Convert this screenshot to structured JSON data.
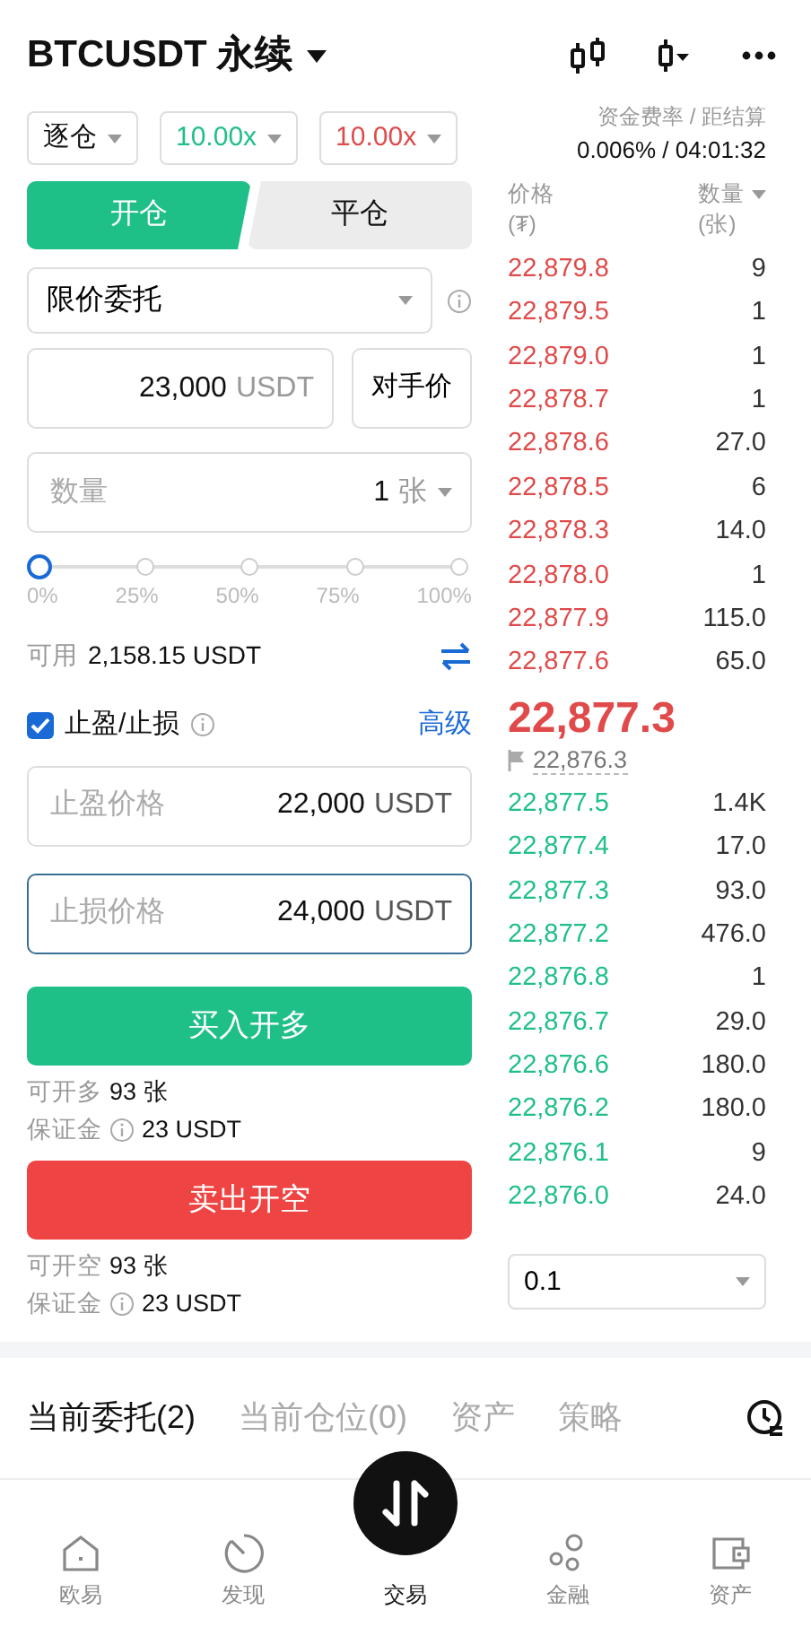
{
  "header": {
    "title": "BTCUSDT 永续"
  },
  "selectors": [
    {
      "kind": "mode",
      "value": "逐仓"
    },
    {
      "kind": "long",
      "value": "10.00x"
    },
    {
      "kind": "short",
      "value": "10.00x"
    }
  ],
  "funding": {
    "label": "资金费率 / 距结算",
    "value": "0.006% / 04:01:32"
  },
  "side_tabs": [
    {
      "label": "开仓",
      "selected": true
    },
    {
      "label": "平仓",
      "selected": false
    }
  ],
  "order_type": {
    "value": "限价委托"
  },
  "price_field": {
    "value": "23,000",
    "unit": "USDT"
  },
  "counterparty_button": "对手价",
  "quantity_field": {
    "placeholder": "数量",
    "value": "1",
    "unit": "张"
  },
  "slider": {
    "level": 0,
    "ticks": [
      "0%",
      "25%",
      "50%",
      "75%",
      "100%"
    ]
  },
  "available": {
    "label": "可用",
    "value": "2,158.15 USDT"
  },
  "tpsl": {
    "label": "止盈/止损",
    "checked": true,
    "advanced": "高级"
  },
  "tp_fields": [
    {
      "placeholder": "止盈价格",
      "value": "22,000",
      "unit": "USDT",
      "focused": false
    },
    {
      "placeholder": "止损价格",
      "value": "24,000",
      "unit": "USDT",
      "focused": true
    }
  ],
  "actions": [
    {
      "kind": "buy",
      "label": "买入开多",
      "max_label": "可开多",
      "max_value": "93 张",
      "margin_label": "保证金",
      "margin_value": "23 USDT"
    },
    {
      "kind": "sell",
      "label": "卖出开空",
      "max_label": "可开空",
      "max_value": "93 张",
      "margin_label": "保证金",
      "margin_value": "23 USDT"
    }
  ],
  "orderbook": {
    "price_header": "价格",
    "price_unit": "(₮)",
    "qty_header": "数量",
    "qty_unit": "(张)",
    "asks": [
      {
        "price": "22,879.8",
        "qty": "9"
      },
      {
        "price": "22,879.5",
        "qty": "1"
      },
      {
        "price": "22,879.0",
        "qty": "1"
      },
      {
        "price": "22,878.7",
        "qty": "1"
      },
      {
        "price": "22,878.6",
        "qty": "27.0"
      },
      {
        "price": "22,878.5",
        "qty": "6"
      },
      {
        "price": "22,878.3",
        "qty": "14.0"
      },
      {
        "price": "22,878.0",
        "qty": "1"
      },
      {
        "price": "22,877.9",
        "qty": "115.0"
      },
      {
        "price": "22,877.6",
        "qty": "65.0"
      }
    ],
    "last_price": "22,877.3",
    "mark_price": "22,876.3",
    "bids": [
      {
        "price": "22,877.5",
        "qty": "1.4K"
      },
      {
        "price": "22,877.4",
        "qty": "17.0"
      },
      {
        "price": "22,877.3",
        "qty": "93.0"
      },
      {
        "price": "22,877.2",
        "qty": "476.0"
      },
      {
        "price": "22,876.8",
        "qty": "1"
      },
      {
        "price": "22,876.7",
        "qty": "29.0"
      },
      {
        "price": "22,876.6",
        "qty": "180.0"
      },
      {
        "price": "22,876.2",
        "qty": "180.0"
      },
      {
        "price": "22,876.1",
        "qty": "9"
      },
      {
        "price": "22,876.0",
        "qty": "24.0"
      }
    ],
    "precision": "0.1"
  },
  "bottom_tabs": [
    {
      "label": "当前委托(2)",
      "selected": true
    },
    {
      "label": "当前仓位(0)",
      "selected": false
    },
    {
      "label": "资产",
      "selected": false
    },
    {
      "label": "策略",
      "selected": false
    }
  ],
  "nav": [
    {
      "kind": "home",
      "label": "欧易",
      "selected": false
    },
    {
      "kind": "discover",
      "label": "发现",
      "selected": false
    },
    {
      "kind": "trade",
      "label": "交易",
      "selected": true
    },
    {
      "kind": "finance",
      "label": "金融",
      "selected": false
    },
    {
      "kind": "wallet",
      "label": "资产",
      "selected": false
    }
  ]
}
